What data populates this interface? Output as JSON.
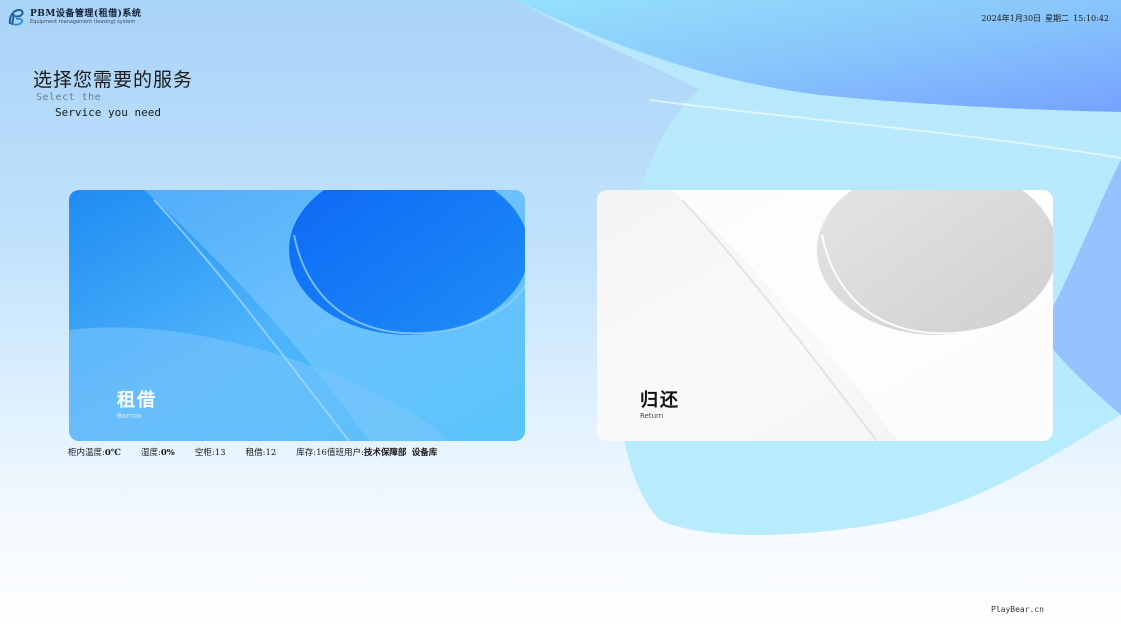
{
  "app": {
    "title": "PBM设备管理(租借)系统",
    "subtitle": "Equipment management (leasing) system"
  },
  "datetime": {
    "date": "2024年1月30日",
    "weekday": "星期二",
    "time": "15:10:42"
  },
  "heading": {
    "title": "选择您需要的服务",
    "sub1": "Select the",
    "sub2": "Service you need"
  },
  "cards": {
    "borrow": {
      "title": "租借",
      "subtitle": "Borrow"
    },
    "return": {
      "title": "归还",
      "subtitle": "Return"
    }
  },
  "status": {
    "temp_label": "柜内温度:",
    "temp_value": "0℃",
    "humidity_label": "湿度:",
    "humidity_value": "0%",
    "empty_label": "空柜:",
    "empty_value": "13",
    "borrowed_label": "租借:",
    "borrowed_value": "12",
    "stock_label": "库存:",
    "stock_value": "16",
    "user_label": "值班用户:",
    "user_dept": "技术保障部",
    "user_name": "设备库"
  },
  "footer": {
    "text": "PlayBear.cn"
  },
  "colors": {
    "borrow_card": "#2a9cf5",
    "return_card": "#f7f7f7",
    "accent": "#6a96ff"
  },
  "icons": {
    "logo": "pb-logo-icon"
  }
}
